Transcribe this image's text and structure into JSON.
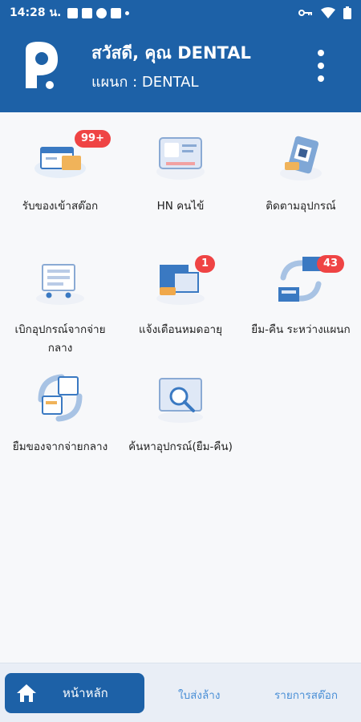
{
  "status_bar": {
    "time": "14:28 น.",
    "icons": [
      "image-icon",
      "shield-icon",
      "security-icon",
      "vpn-icon"
    ],
    "right_icons": [
      "key-icon",
      "wifi-icon",
      "battery-icon"
    ]
  },
  "header": {
    "greeting": "สวัสดี, คุณ DENTAL",
    "department": "แผนก : DENTAL"
  },
  "menu": [
    {
      "label": "รับของเข้าสต๊อก",
      "badge": "99+"
    },
    {
      "label": "HN คนไข้",
      "badge": ""
    },
    {
      "label": "ติดตามอุปกรณ์",
      "badge": ""
    },
    {
      "label": "เบิกอุปกรณ์จากจ่ายกลาง",
      "badge": ""
    },
    {
      "label": "แจ้งเตือนหมดอายุ",
      "badge": "1"
    },
    {
      "label": "ยืม-คืน ระหว่างแผนก",
      "badge": "43"
    },
    {
      "label": "ยืมของจากจ่ายกลาง",
      "badge": ""
    },
    {
      "label": "ค้นหาอุปกรณ์(ยืม-คืน)",
      "badge": ""
    }
  ],
  "bottom_nav": {
    "home": "หน้าหลัก",
    "item2": "ใบส่งล้าง",
    "item3": "รายการสต๊อก"
  },
  "colors": {
    "primary": "#1d61a7",
    "badge": "#ef4444",
    "nav_link": "#4a8fd6"
  }
}
